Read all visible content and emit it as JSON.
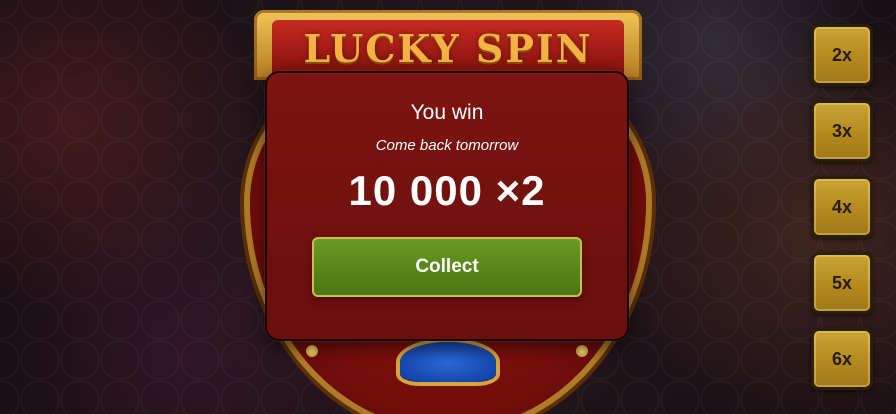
{
  "board": {
    "title": "LUCKY SPIN"
  },
  "popup": {
    "title": "You win",
    "subtitle": "Come back tomorrow",
    "amount": "10 000 ×2",
    "collect_label": "Collect"
  },
  "multipliers": [
    "2x",
    "3x",
    "4x",
    "5x",
    "6x"
  ],
  "colors": {
    "popup_bg": "#7c1410",
    "collect_green": "#5b8a1c",
    "gold": "#c9a434"
  }
}
